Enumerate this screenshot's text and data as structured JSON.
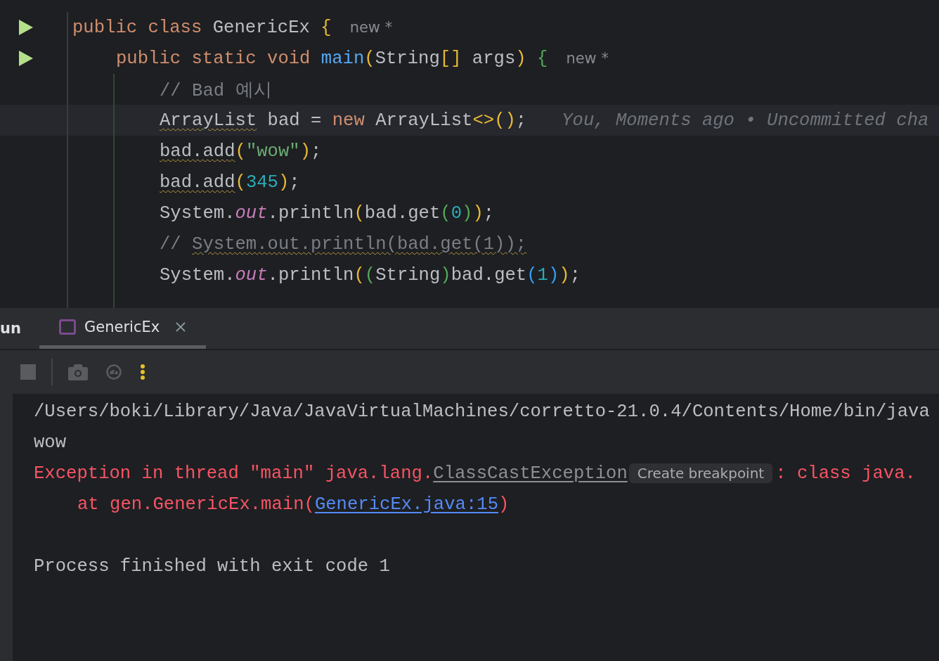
{
  "editor": {
    "lines": [
      {
        "run": true,
        "current": false,
        "hint": "new *",
        "tokens": [
          {
            "text": "public class ",
            "kind": "kw"
          },
          {
            "text": "GenericEx ",
            "kind": "plain"
          },
          {
            "text": "{",
            "kind": "p1"
          }
        ],
        "children": [
          {
            "run": true,
            "current": false,
            "hint": "new *",
            "tokens": [
              {
                "text": "public static void ",
                "kind": "kw"
              },
              {
                "text": "main",
                "kind": "fn"
              },
              {
                "text": "(",
                "kind": "p1"
              },
              {
                "text": "String",
                "kind": "plain"
              },
              {
                "text": "[]",
                "kind": "p1"
              },
              {
                "text": " args",
                "kind": "plain"
              },
              {
                "text": ") ",
                "kind": "p1"
              },
              {
                "text": "{",
                "kind": "p2"
              }
            ],
            "children": [
              {
                "run": false,
                "current": false,
                "tokens": [
                  {
                    "text": "// Bad 예시",
                    "kind": "comment"
                  }
                ]
              },
              {
                "run": false,
                "current": true,
                "blame": "You, Moments ago • Uncommitted cha",
                "tokens": [
                  {
                    "text": "ArrayList",
                    "kind": "plain",
                    "warn": true
                  },
                  {
                    "text": " bad = ",
                    "kind": "plain"
                  },
                  {
                    "text": "new ",
                    "kind": "kw"
                  },
                  {
                    "text": "ArrayList",
                    "kind": "plain"
                  },
                  {
                    "text": "<>()",
                    "kind": "p1"
                  },
                  {
                    "text": ";",
                    "kind": "plain"
                  }
                ]
              },
              {
                "run": false,
                "current": false,
                "tokens": [
                  {
                    "text": "bad.add",
                    "kind": "plain",
                    "warn": true
                  },
                  {
                    "text": "(",
                    "kind": "p1"
                  },
                  {
                    "text": "\"wow\"",
                    "kind": "str"
                  },
                  {
                    "text": ")",
                    "kind": "p1"
                  },
                  {
                    "text": ";",
                    "kind": "plain"
                  }
                ]
              },
              {
                "run": false,
                "current": false,
                "tokens": [
                  {
                    "text": "bad.add",
                    "kind": "plain",
                    "warn": true
                  },
                  {
                    "text": "(",
                    "kind": "p1"
                  },
                  {
                    "text": "345",
                    "kind": "num"
                  },
                  {
                    "text": ")",
                    "kind": "p1"
                  },
                  {
                    "text": ";",
                    "kind": "plain"
                  }
                ]
              },
              {
                "run": false,
                "current": false,
                "tokens": [
                  {
                    "text": "System.",
                    "kind": "plain"
                  },
                  {
                    "text": "out",
                    "kind": "field"
                  },
                  {
                    "text": ".println",
                    "kind": "plain"
                  },
                  {
                    "text": "(",
                    "kind": "p1"
                  },
                  {
                    "text": "bad.get",
                    "kind": "plain"
                  },
                  {
                    "text": "(",
                    "kind": "p2"
                  },
                  {
                    "text": "0",
                    "kind": "num"
                  },
                  {
                    "text": ")",
                    "kind": "p2"
                  },
                  {
                    "text": ")",
                    "kind": "p1"
                  },
                  {
                    "text": ";",
                    "kind": "plain"
                  }
                ]
              },
              {
                "run": false,
                "current": false,
                "tokens": [
                  {
                    "text": "// ",
                    "kind": "comment"
                  },
                  {
                    "text": "System.out.println(bad.get(1));",
                    "kind": "comment",
                    "warn": true
                  }
                ]
              },
              {
                "run": false,
                "current": false,
                "tokens": [
                  {
                    "text": "System.",
                    "kind": "plain"
                  },
                  {
                    "text": "out",
                    "kind": "field"
                  },
                  {
                    "text": ".println",
                    "kind": "plain"
                  },
                  {
                    "text": "(",
                    "kind": "p1"
                  },
                  {
                    "text": "(",
                    "kind": "p2"
                  },
                  {
                    "text": "String",
                    "kind": "plain"
                  },
                  {
                    "text": ")",
                    "kind": "p2"
                  },
                  {
                    "text": "bad.get",
                    "kind": "plain"
                  },
                  {
                    "text": "(",
                    "kind": "p3"
                  },
                  {
                    "text": "1",
                    "kind": "num"
                  },
                  {
                    "text": ")",
                    "kind": "p3"
                  },
                  {
                    "text": ")",
                    "kind": "p1"
                  },
                  {
                    "text": ";",
                    "kind": "plain"
                  }
                ]
              }
            ]
          }
        ]
      }
    ]
  },
  "run_panel": {
    "title": "un",
    "tabs": [
      {
        "label": "GenericEx",
        "selected": true
      }
    ],
    "console": [
      {
        "kind": "command",
        "tokens": [
          {
            "text": "/Users/boki/Library/Java/JavaVirtualMachines/corretto-21.0.4/Contents/Home/bin/java",
            "kind": "out"
          }
        ]
      },
      {
        "kind": "output",
        "tokens": [
          {
            "text": "wow",
            "kind": "out"
          }
        ]
      },
      {
        "kind": "error",
        "tokens": [
          {
            "text": "Exception in thread \"main\" java.lang.",
            "kind": "err"
          },
          {
            "text": "ClassCastException",
            "kind": "link"
          },
          {
            "text": "Create breakpoint",
            "kind": "badge"
          },
          {
            "text": ": class java.",
            "kind": "err"
          }
        ]
      },
      {
        "kind": "trace",
        "tokens": [
          {
            "text": "at gen.GenericEx.main(",
            "kind": "err"
          },
          {
            "text": "GenericEx.java:15",
            "kind": "source"
          },
          {
            "text": ")",
            "kind": "err"
          }
        ]
      },
      {
        "kind": "summary",
        "tokens": [
          {
            "text": "Process finished with exit code 1",
            "kind": "out"
          }
        ]
      }
    ]
  }
}
